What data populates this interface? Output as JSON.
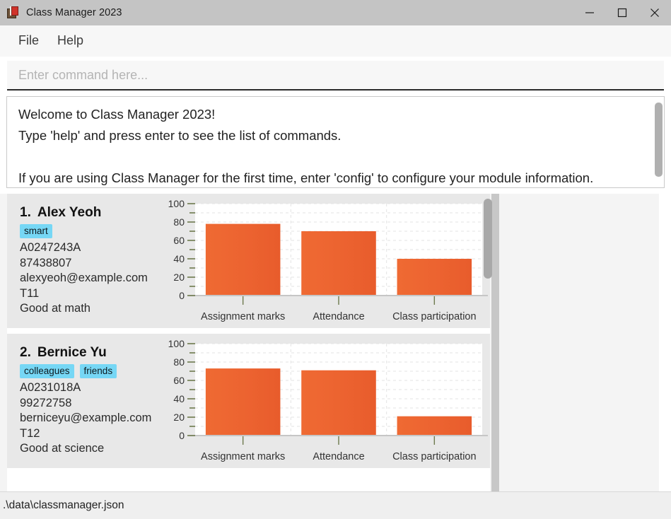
{
  "window": {
    "title": "Class Manager 2023",
    "icon": "books-icon",
    "controls": {
      "minimize": "minimize-icon",
      "maximize": "maximize-icon",
      "close": "close-icon"
    }
  },
  "menubar": {
    "items": [
      {
        "label": "File"
      },
      {
        "label": "Help"
      }
    ]
  },
  "command": {
    "value": "",
    "placeholder": "Enter command here..."
  },
  "result": {
    "text": "Welcome to Class Manager 2023!\nType 'help' and press enter to see the list of commands.\n\nIf you are using Class Manager for the first time, enter 'config' to configure your module information."
  },
  "students": [
    {
      "index": "1.",
      "name": "Alex Yeoh",
      "tags": [
        "smart"
      ],
      "student_id": "A0247243A",
      "phone": "87438807",
      "email": "alexyeoh@example.com",
      "tutorial": "T11",
      "comment": "Good at math"
    },
    {
      "index": "2.",
      "name": "Bernice Yu",
      "tags": [
        "colleagues",
        "friends"
      ],
      "student_id": "A0231018A",
      "phone": "99272758",
      "email": "berniceyu@example.com",
      "tutorial": "T12",
      "comment": "Good at science"
    }
  ],
  "statusbar": {
    "file_path": ".\\data\\classmanager.json"
  },
  "colors": {
    "bar": "#ec6330",
    "tag_bg": "#76d7f5",
    "card_bg": "#e8e8e8",
    "titlebar_bg": "#c4c4c4",
    "axis_tick": "#6e7a4e"
  },
  "chart_data": [
    {
      "type": "bar",
      "title": "",
      "student": "Alex Yeoh",
      "categories": [
        "Assignment marks",
        "Attendance",
        "Class participation"
      ],
      "values": [
        78,
        70,
        40
      ],
      "xlabel": "",
      "ylabel": "",
      "ylim": [
        0,
        100
      ],
      "yticks": [
        0,
        20,
        40,
        60,
        80,
        100
      ],
      "minor_tick_step": 10,
      "grid": true,
      "legend": false
    },
    {
      "type": "bar",
      "title": "",
      "student": "Bernice Yu",
      "categories": [
        "Assignment marks",
        "Attendance",
        "Class participation"
      ],
      "values": [
        73,
        71,
        21
      ],
      "xlabel": "",
      "ylabel": "",
      "ylim": [
        0,
        100
      ],
      "yticks": [
        0,
        20,
        40,
        60,
        80,
        100
      ],
      "minor_tick_step": 10,
      "grid": true,
      "legend": false
    }
  ]
}
